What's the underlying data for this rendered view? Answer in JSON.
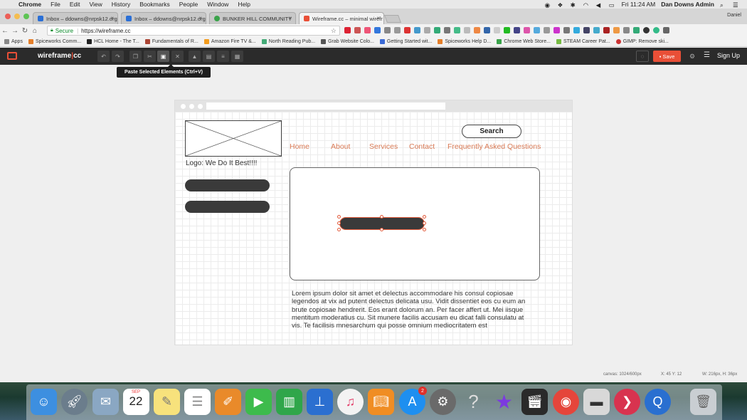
{
  "menubar": {
    "app": "Chrome",
    "items": [
      "File",
      "Edit",
      "View",
      "History",
      "Bookmarks",
      "People",
      "Window",
      "Help"
    ],
    "clock": "Fri 11:24 AM",
    "user": "Dan Downs Admin"
  },
  "tabs": [
    {
      "label": "Inbox – ddowns@nrpsk12.org",
      "color": "#2a6fd6"
    },
    {
      "label": "Inbox – ddowns@nrpsk12.org",
      "color": "#2a6fd6"
    },
    {
      "label": "BUNKER HILL COMMUNITY",
      "color": "#3aa34a"
    },
    {
      "label": "Wireframe.cc – minimal wirefr",
      "color": "#e94f37"
    }
  ],
  "profile_name": "Daniel",
  "address": {
    "secure_label": "Secure",
    "url": "https://wireframe.cc"
  },
  "bookmarks": [
    {
      "label": "Apps",
      "color": "#888"
    },
    {
      "label": "Spiceworks Comm...",
      "color": "#e57f2b"
    },
    {
      "label": "HCL Home - The T...",
      "color": "#222"
    },
    {
      "label": "Fundamentals of R...",
      "color": "#a43"
    },
    {
      "label": "Amazon Fire TV &...",
      "color": "#f29b1d"
    },
    {
      "label": "North Reading Pub...",
      "color": "#4a7"
    },
    {
      "label": "Grab Website Colo...",
      "color": "#555"
    },
    {
      "label": "Getting Started wit...",
      "color": "#3b6ad6"
    },
    {
      "label": "Spiceworks Help D...",
      "color": "#e57f2b"
    },
    {
      "label": "Chrome Web Store...",
      "color": "#3aa34a"
    },
    {
      "label": "STEAM Career Pat...",
      "color": "#7b4"
    },
    {
      "label": "GIMP: Remove ski...",
      "color": "#c33"
    }
  ],
  "app": {
    "title_a": "wireframe",
    "title_b": "cc",
    "save_label": "Save",
    "signup_label": "Sign Up",
    "tooltip": "Paste Selected Elements (Ctrl+V)"
  },
  "wireframe": {
    "logo_caption": "Logo: We Do It Best!!!!",
    "search_label": "Search",
    "nav": [
      "Home",
      "About",
      "Services",
      "Contact",
      "Frequently Asked Questions"
    ],
    "lorem": "Lorem ipsum dolor sit amet et delectus accommodare his consul copiosae legendos at vix ad putent delectus delicata usu. Vidit dissentiet eos cu eum an brute copiosae hendrerit. Eos erant dolorum an. Per facer affert ut. Mei iisque mentitum moderatius cu. Sit munere facilis accusam eu dicat falli consulatu at vis. Te facilisis mnesarchum qui posse omnium mediocritatem est"
  },
  "status": {
    "canvas": "canvas: 1024/600px",
    "coords": "X: 45 Y: 12",
    "size": "W: 216px, H: 36px"
  },
  "dock": {
    "calendar_month": "SEP",
    "calendar_day": "22",
    "appstore_badge": "2"
  },
  "colors": {
    "accent": "#e94f37",
    "nav_link": "#d97a55",
    "toolbar_bg": "#2b2b2b"
  }
}
